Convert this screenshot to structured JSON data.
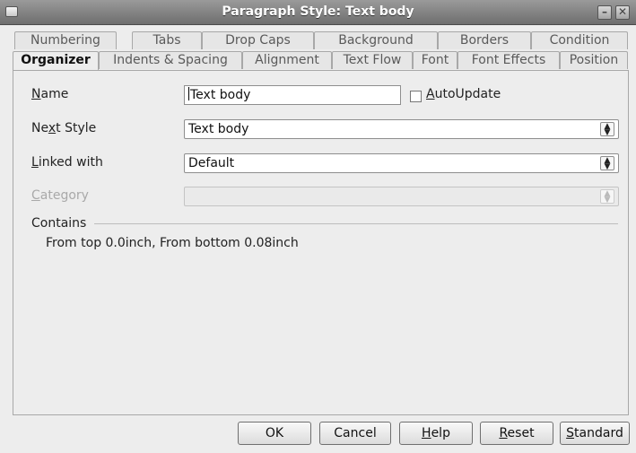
{
  "window": {
    "title": "Paragraph Style: Text body",
    "minimize_glyph": "–",
    "close_glyph": "✕"
  },
  "tabs": {
    "row_back": [
      "Numbering",
      "Tabs",
      "Drop Caps",
      "Background",
      "Borders",
      "Condition"
    ],
    "row_front": [
      "Organizer",
      "Indents & Spacing",
      "Alignment",
      "Text Flow",
      "Font",
      "Font Effects",
      "Position"
    ],
    "active": "Organizer"
  },
  "organizer": {
    "name_label": "Name",
    "name_value": "Text body",
    "autoupdate_label": "AutoUpdate",
    "autoupdate_checked": false,
    "next_style_label": "Next Style",
    "next_style_value": "Text body",
    "linked_with_label": "Linked with",
    "linked_with_value": "Default",
    "category_label": "Category",
    "category_value": "",
    "contains_label": "Contains",
    "contains_text": "From top 0.0inch, From bottom 0.08inch"
  },
  "buttons": {
    "ok": "OK",
    "cancel": "Cancel",
    "help": "Help",
    "reset": "Reset",
    "standard": "Standard"
  },
  "icons": {
    "spin": "spin-updown-icon",
    "app": "window-menu-icon"
  }
}
